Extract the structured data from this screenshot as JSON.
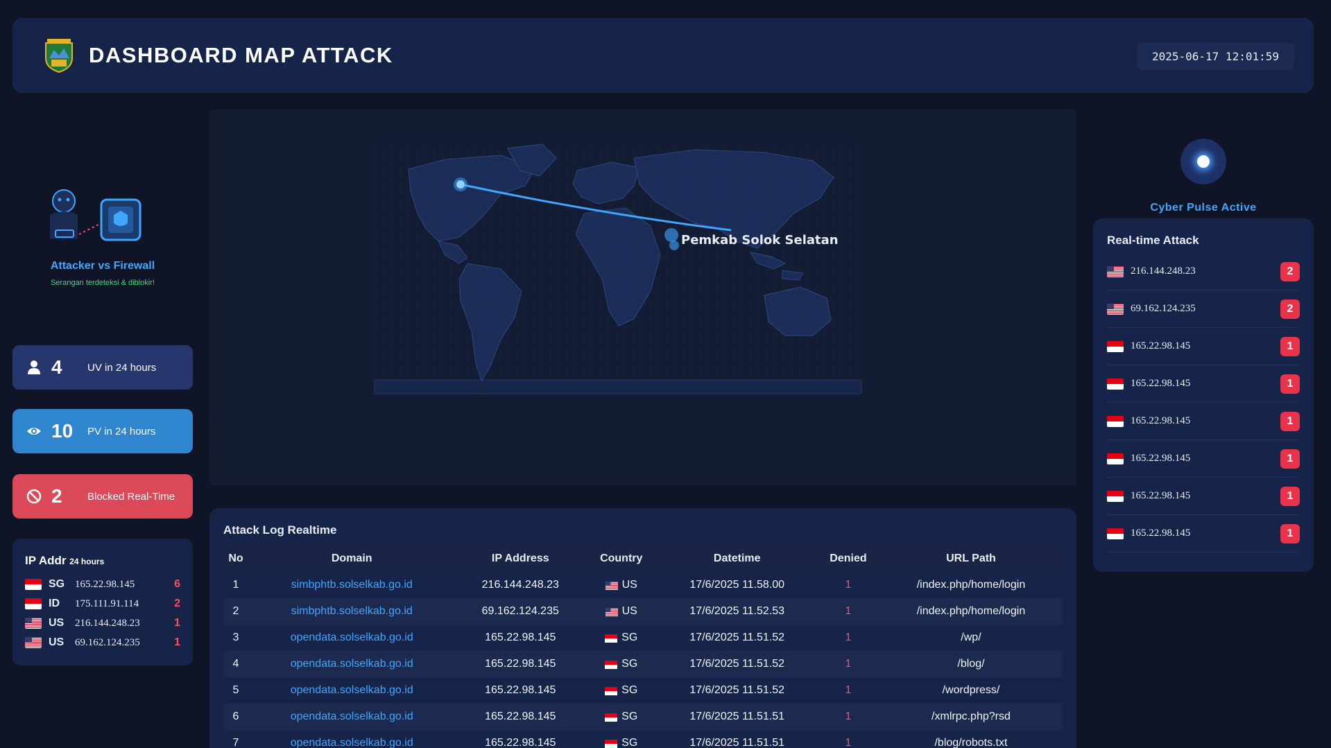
{
  "header": {
    "title": "DASHBOARD MAP ATTACK",
    "datetime": "2025-06-17 12:01:59"
  },
  "illustration": {
    "title": "Attacker vs Firewall",
    "subtitle": "Serangan terdeteksi & diblokir!"
  },
  "stats": [
    {
      "icon": "user-icon",
      "value": "4",
      "label": "UV in 24 hours",
      "color": "#26376d"
    },
    {
      "icon": "eye-icon",
      "value": "10",
      "label": "PV in 24 hours",
      "color": "#2f86cf"
    },
    {
      "icon": "block-icon",
      "value": "2",
      "label": "Blocked Real-Time",
      "color": "#dc4a5a"
    }
  ],
  "ip_addr": {
    "title": "IP Addr",
    "subtitle": "24 hours",
    "rows": [
      {
        "flag": "id",
        "country": "SG",
        "ip": "165.22.98.145",
        "count": "6"
      },
      {
        "flag": "id",
        "country": "ID",
        "ip": "175.111.91.114",
        "count": "2"
      },
      {
        "flag": "us",
        "country": "US",
        "ip": "216.144.248.23",
        "count": "1"
      },
      {
        "flag": "us",
        "country": "US",
        "ip": "69.162.124.235",
        "count": "1"
      }
    ]
  },
  "map": {
    "target_label": "Pemkab Solok Selatan"
  },
  "attack_log": {
    "title": "Attack Log Realtime",
    "columns": [
      "No",
      "Domain",
      "IP Address",
      "Country",
      "Datetime",
      "Denied",
      "URL Path"
    ],
    "rows": [
      {
        "no": "1",
        "domain": "simbphtb.solselkab.go.id",
        "ip": "216.144.248.23",
        "flag": "us",
        "country": "US",
        "datetime": "17/6/2025 11.58.00",
        "denied": "1",
        "path": "/index.php/home/login"
      },
      {
        "no": "2",
        "domain": "simbphtb.solselkab.go.id",
        "ip": "69.162.124.235",
        "flag": "us",
        "country": "US",
        "datetime": "17/6/2025 11.52.53",
        "denied": "1",
        "path": "/index.php/home/login"
      },
      {
        "no": "3",
        "domain": "opendata.solselkab.go.id",
        "ip": "165.22.98.145",
        "flag": "id",
        "country": "SG",
        "datetime": "17/6/2025 11.51.52",
        "denied": "1",
        "path": "/wp/"
      },
      {
        "no": "4",
        "domain": "opendata.solselkab.go.id",
        "ip": "165.22.98.145",
        "flag": "id",
        "country": "SG",
        "datetime": "17/6/2025 11.51.52",
        "denied": "1",
        "path": "/blog/"
      },
      {
        "no": "5",
        "domain": "opendata.solselkab.go.id",
        "ip": "165.22.98.145",
        "flag": "id",
        "country": "SG",
        "datetime": "17/6/2025 11.51.52",
        "denied": "1",
        "path": "/wordpress/"
      },
      {
        "no": "6",
        "domain": "opendata.solselkab.go.id",
        "ip": "165.22.98.145",
        "flag": "id",
        "country": "SG",
        "datetime": "17/6/2025 11.51.51",
        "denied": "1",
        "path": "/xmlrpc.php?rsd"
      },
      {
        "no": "7",
        "domain": "opendata.solselkab.go.id",
        "ip": "165.22.98.145",
        "flag": "id",
        "country": "SG",
        "datetime": "17/6/2025 11.51.51",
        "denied": "1",
        "path": "/blog/robots.txt"
      }
    ]
  },
  "pulse": {
    "label": "Cyber Pulse Active"
  },
  "realtime": {
    "title": "Real-time Attack",
    "rows": [
      {
        "flag": "us",
        "ip": "216.144.248.23",
        "count": "2"
      },
      {
        "flag": "us",
        "ip": "69.162.124.235",
        "count": "2"
      },
      {
        "flag": "id",
        "ip": "165.22.98.145",
        "count": "1"
      },
      {
        "flag": "id",
        "ip": "165.22.98.145",
        "count": "1"
      },
      {
        "flag": "id",
        "ip": "165.22.98.145",
        "count": "1"
      },
      {
        "flag": "id",
        "ip": "165.22.98.145",
        "count": "1"
      },
      {
        "flag": "id",
        "ip": "165.22.98.145",
        "count": "1"
      },
      {
        "flag": "id",
        "ip": "165.22.98.145",
        "count": "1"
      }
    ]
  }
}
